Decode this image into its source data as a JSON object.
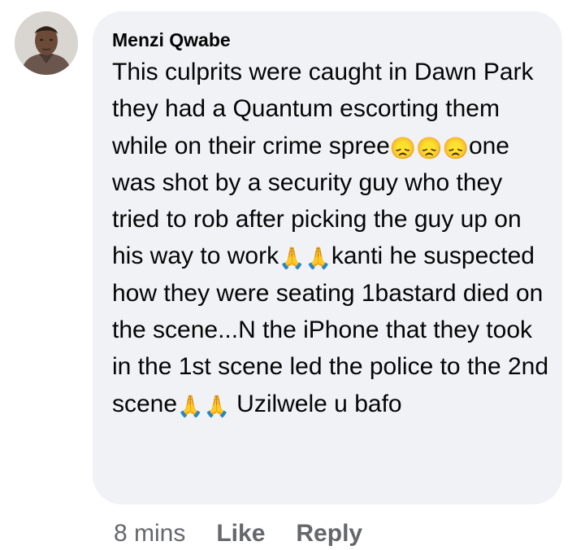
{
  "comment": {
    "author": "Menzi Qwabe",
    "segments": [
      {
        "type": "text",
        "value": "This culprits were caught in Dawn Park they had a Quantum escorting them while on their crime spree"
      },
      {
        "type": "emoji",
        "value": "😞"
      },
      {
        "type": "emoji",
        "value": "😞"
      },
      {
        "type": "emoji",
        "value": "😞"
      },
      {
        "type": "text",
        "value": "one was shot by a security guy who they tried to rob after picking the guy up on his way to work"
      },
      {
        "type": "emoji",
        "value": "🙏"
      },
      {
        "type": "emoji",
        "value": "🙏"
      },
      {
        "type": "text",
        "value": "kanti he suspected how they were seating 1bastard died on the scene...N the iPhone that they took in the 1st scene led the police to the 2nd scene"
      },
      {
        "type": "emoji",
        "value": "🙏"
      },
      {
        "type": "emoji",
        "value": "🙏"
      },
      {
        "type": "text",
        "value": " Uzilwele u bafo"
      }
    ]
  },
  "actions": {
    "time": "8 mins",
    "like": "Like",
    "reply": "Reply"
  },
  "colors": {
    "bubble": "#f0f2f5",
    "text": "#050505",
    "secondary": "#65676b"
  }
}
